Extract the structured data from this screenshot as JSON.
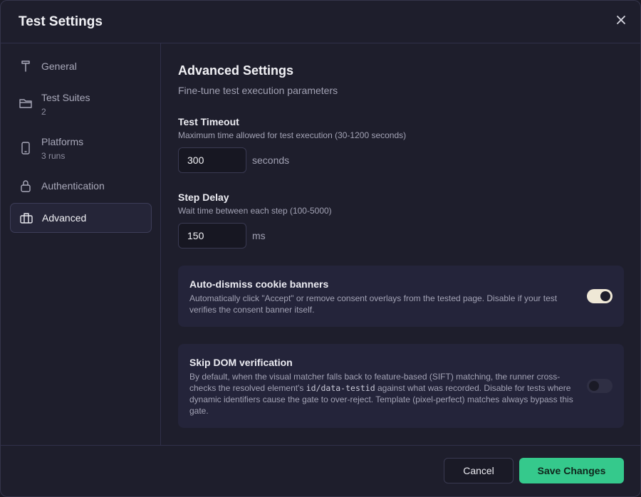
{
  "dialog": {
    "title": "Test Settings"
  },
  "sidebar": {
    "items": [
      {
        "label": "General",
        "sub": ""
      },
      {
        "label": "Test Suites",
        "sub": "2"
      },
      {
        "label": "Platforms",
        "sub": "3 runs"
      },
      {
        "label": "Authentication",
        "sub": ""
      },
      {
        "label": "Advanced",
        "sub": "",
        "active": true
      }
    ]
  },
  "content": {
    "title": "Advanced Settings",
    "subtitle": "Fine-tune test execution parameters",
    "timeout": {
      "label": "Test Timeout",
      "help": "Maximum time allowed for test execution (30-1200 seconds)",
      "value": "300",
      "unit": "seconds"
    },
    "step_delay": {
      "label": "Step Delay",
      "help": "Wait time between each step (100-5000)",
      "value": "150",
      "unit": "ms"
    },
    "cookie": {
      "title": "Auto-dismiss cookie banners",
      "desc": "Automatically click \"Accept\" or remove consent overlays from the tested page. Disable if your test verifies the consent banner itself.",
      "enabled": true
    },
    "skip_dom": {
      "title": "Skip DOM verification",
      "desc_1": "By default, when the visual matcher falls back to feature-based (SIFT) matching, the runner cross-checks the resolved element's ",
      "code": "id/data-testid",
      "desc_2": " against what was recorded. Disable for tests where dynamic identifiers cause the gate to over-reject. Template (pixel-perfect) matches always bypass this gate.",
      "enabled": false
    }
  },
  "footer": {
    "cancel_label": "Cancel",
    "save_label": "Save Changes"
  },
  "colors": {
    "accent": "#35c98c",
    "toggle_on": "#efe8d6",
    "background": "#1e1e2c"
  }
}
